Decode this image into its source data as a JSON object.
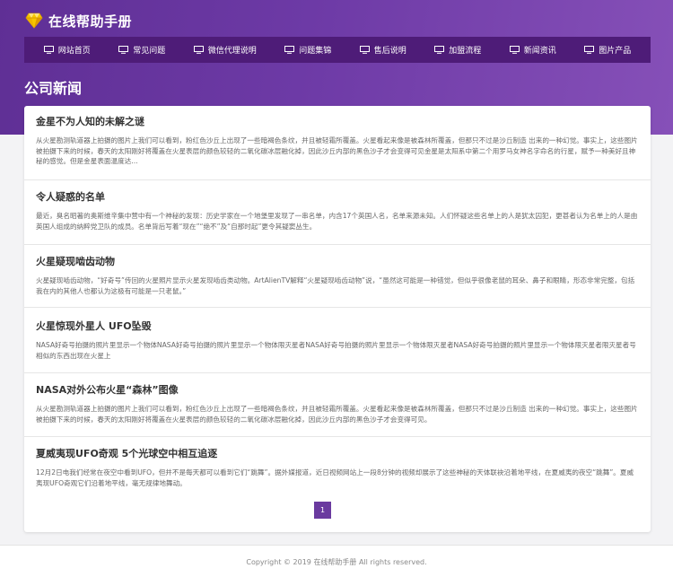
{
  "site": {
    "title": "在线帮助手册"
  },
  "nav": {
    "items": [
      {
        "label": "网站首页"
      },
      {
        "label": "常见问题"
      },
      {
        "label": "微信代理说明"
      },
      {
        "label": "问题集锦"
      },
      {
        "label": "售后说明"
      },
      {
        "label": "加盟流程"
      },
      {
        "label": "新闻资讯"
      },
      {
        "label": "图片产品"
      }
    ]
  },
  "page": {
    "title": "公司新闻"
  },
  "articles": [
    {
      "title": "金星不为人知的未解之谜",
      "excerpt": "从火星勘测轨道器上拍摄的图片上我们可以看到，粉红色沙丘上出现了一些暗褐色条纹，并且被轻霜所覆盖。火星看起来像是被森林所覆盖，但那只不过是沙丘制造 出来的一种幻觉。事实上，这些图片被拍摄下来的时候，春天的太阳刚好将覆盖在火星表层的颜色较轻的二氧化碳冰层融化掉，因此沙丘内部的黑色沙子才会变得可见金星是太阳系中第二个用罗马女神名字命名的行星，赋予一种美好且神秘的感觉。但是金星表面温度达..."
    },
    {
      "title": "令人疑惑的名单",
      "excerpt": "最近，臭名昭著的奥斯维辛集中营中有一个神秘的发现：历史学家在一个地堡里发现了一串名单，内含17个英国人名，名单来源未知。人们怀疑这些名单上的人是犹太囚犯，更甚者认为名单上的人是由英国人组成的纳粹党卫队的成员。名单背后写着“现在”“绝不”及“自那时起”更令其疑窦丛生。"
    },
    {
      "title": "火星疑现啮齿动物",
      "excerpt": "火星疑现啮齿动物，“好奇号”传回的火星照片显示火星发现啮齿类动物。ArtAlienTV解释“火星疑现啮齿动物”说，“虽然这可能是一种错觉，但似乎很像老鼠的耳朵、鼻子和眼睛，形态非常完整，包括我在内的其他人也都认为这极有可能是一只老鼠。”"
    },
    {
      "title": "火星惊现外星人 UFO坠毁",
      "excerpt": "NASA好奇号拍摄的照片里显示一个物体NASA好奇号拍摄的照片里显示一个物体限灭星者NASA好奇号拍摄的照片里显示一个物体限灭星者NASA好奇号拍摄的照片里显示一个物体限灭星者限灭星者号相似的东西出现在火星上"
    },
    {
      "title": "NASA对外公布火星“森林”图像",
      "excerpt": "从火星勘测轨道器上拍摄的图片上我们可以看到，粉红色沙丘上出现了一些暗褐色条纹，并且被轻霜所覆盖。火星看起来像是被森林所覆盖，但那只不过是沙丘制造 出来的一种幻觉。事实上，这些图片被拍摄下来的时候，春天的太阳刚好将覆盖在火星表层的颜色较轻的二氧化碳冰层融化掉，因此沙丘内部的黑色沙子才会变得可见。"
    },
    {
      "title": "夏威夷现UFO奇观 5个光球空中相互追逐",
      "excerpt": "12月2日电我们经常在夜空中看到UFO，但并不是每天都可以看到它们“跳舞”。据外媒报道，近日视频网站上一段8分钟的视频却展示了这些神秘的天体联袂沿着地平线，在夏威夷的夜空“跳舞”。夏威夷现UFO奇观它们沿着地平线，毫无规律地舞动。"
    }
  ],
  "pagination": {
    "current": "1"
  },
  "footer": {
    "copyright": "Copyright © 2019 在线帮助手册 All rights reserved."
  },
  "colors": {
    "brand": "#6a3a9f",
    "nav_background": "#4e1c78",
    "background": "#f3f3f5"
  }
}
